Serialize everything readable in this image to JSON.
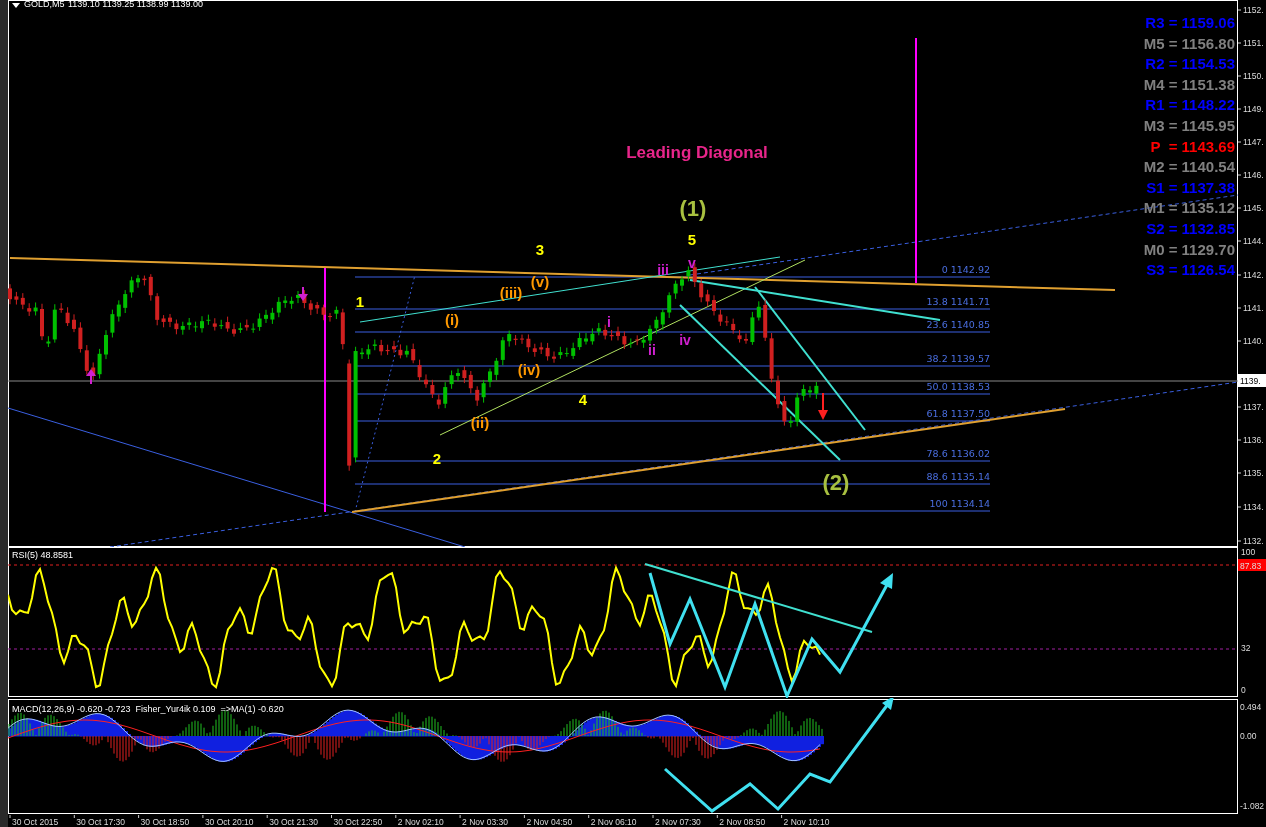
{
  "header": {
    "symbol": "GOLD,M5",
    "ohlc": "1139.10 1139.25 1138.99 1139.00"
  },
  "main_chart": {
    "price_axis": [
      "1152.",
      "1151.",
      "1150.",
      "1149.",
      "1147.",
      "1146.",
      "1145.",
      "1144.",
      "1142.",
      "1141.",
      "1140.",
      "1137.",
      "1136.",
      "1135.",
      "1134.",
      "1132."
    ],
    "current_price": "1139.",
    "fib_levels": [
      "0 1142.92",
      "13.8 1141.71",
      "23.6 1140.85",
      "38.2 1139.57",
      "50.0 1138.53",
      "61.8 1137.50",
      "78.6 1136.02",
      "88.6 1135.14",
      "100 1134.14"
    ],
    "pivots": [
      {
        "label": "R3 = 1159.06",
        "color": "#0000ff"
      },
      {
        "label": "M5 = 1156.80",
        "color": "#808080"
      },
      {
        "label": "R2 = 1154.53",
        "color": "#0000ff"
      },
      {
        "label": "M4 = 1151.38",
        "color": "#808080"
      },
      {
        "label": "R1 = 1148.22",
        "color": "#0000ff"
      },
      {
        "label": "M3 = 1145.95",
        "color": "#808080"
      },
      {
        "label": "P  = 1143.69",
        "color": "#ff0000"
      },
      {
        "label": "M2 = 1140.54",
        "color": "#808080"
      },
      {
        "label": "S1 = 1137.38",
        "color": "#0000ff"
      },
      {
        "label": "M1 = 1135.12",
        "color": "#808080"
      },
      {
        "label": "S2 = 1132.85",
        "color": "#0000ff"
      },
      {
        "label": "M0 = 1129.70",
        "color": "#808080"
      },
      {
        "label": "S3 = 1126.54",
        "color": "#0000ff"
      }
    ],
    "annotations": [
      {
        "text": "Leading Diagonal",
        "color": "#e8258a"
      },
      {
        "text": "(1)",
        "color": "#a8c040"
      },
      {
        "text": "5",
        "color": "#ffff00"
      },
      {
        "text": "3",
        "color": "#ffff00"
      },
      {
        "text": "1",
        "color": "#ffff00"
      },
      {
        "text": "2",
        "color": "#ffff00"
      },
      {
        "text": "4",
        "color": "#ffff00"
      },
      {
        "text": "(2)",
        "color": "#a8c040"
      },
      {
        "text": "(i)",
        "color": "#ff9900"
      },
      {
        "text": "(ii)",
        "color": "#ff9900"
      },
      {
        "text": "(iii)",
        "color": "#ff9900"
      },
      {
        "text": "(iv)",
        "color": "#ff9900"
      },
      {
        "text": "(v)",
        "color": "#ff9900"
      },
      {
        "text": "i",
        "color": "#d020d0"
      },
      {
        "text": "ii",
        "color": "#d020d0"
      },
      {
        "text": "iii",
        "color": "#d020d0"
      },
      {
        "text": "iv",
        "color": "#d020d0"
      },
      {
        "text": "v",
        "color": "#d020d0"
      }
    ]
  },
  "rsi": {
    "title": "RSI(5) 48.8581",
    "axis": [
      "100",
      "32",
      "0"
    ],
    "level_badge": "87.83"
  },
  "macd": {
    "title": "MACD(12,26,9) -0.620 -0.723  Fisher_Yur4ik 0.109  =>MA(1) -0.620",
    "axis": [
      "0.494",
      "0.00",
      "-1.082"
    ]
  },
  "time_axis": [
    "30 Oct 2015",
    "30 Oct 17:30",
    "30 Oct 18:50",
    "30 Oct 20:10",
    "30 Oct 21:30",
    "30 Oct 22:50",
    "2 Nov 02:10",
    "2 Nov 03:30",
    "2 Nov 04:50",
    "2 Nov 06:10",
    "2 Nov 07:30",
    "2 Nov 08:50",
    "2 Nov 10:10"
  ]
}
